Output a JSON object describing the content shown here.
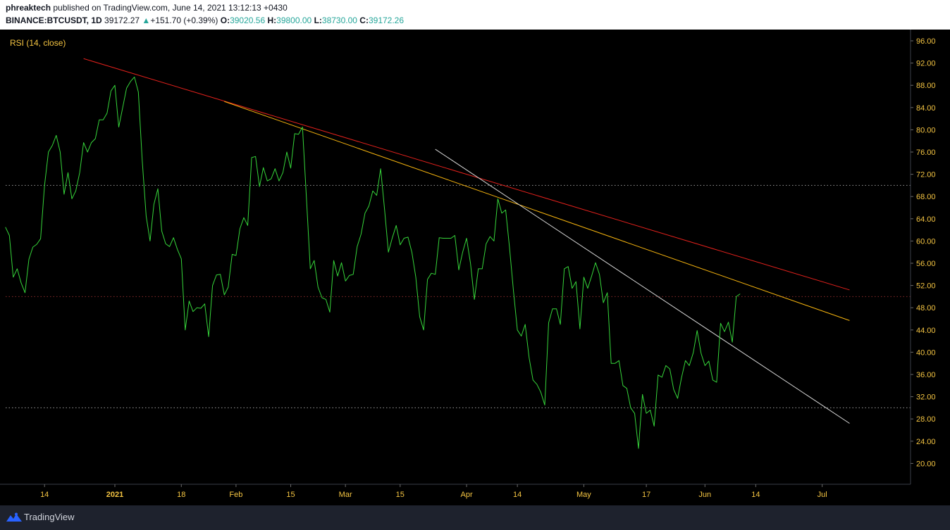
{
  "header": {
    "publisher": "phreaktech",
    "published_text": "published on TradingView.com, June 14, 2021 13:12:13 +0430",
    "symbol": "BINANCE:BTCUSDT, 1D",
    "last_price": "39172.27",
    "change_arrow": "▲",
    "change": "+151.70 (+0.39%)",
    "o_label": "O:",
    "open": "39020.56",
    "h_label": "H:",
    "high": "39800.00",
    "l_label": "L:",
    "low": "38730.00",
    "c_label": "C:",
    "close": "39172.26"
  },
  "footer": {
    "brand": "TradingView"
  },
  "colors": {
    "background": "#000000",
    "rsi_line": "#36d53a",
    "accent_up": "#26a69a",
    "trendline_red": "#e3211c",
    "trendline_orange": "#f6b40e",
    "trendline_white": "#d9d9d9",
    "indicator_label": "#f5c542",
    "axis_text": "#f5c542"
  },
  "chart_data": {
    "type": "line",
    "title": "RSI (14, close)",
    "y_axis_position": "right",
    "ylim": [
      16,
      99
    ],
    "yticks": [
      "96.00",
      "92.00",
      "88.00",
      "84.00",
      "80.00",
      "76.00",
      "72.00",
      "68.00",
      "64.00",
      "60.00",
      "56.00",
      "52.00",
      "48.00",
      "44.00",
      "40.00",
      "36.00",
      "32.00",
      "28.00",
      "24.00",
      "20.00"
    ],
    "reference_levels": [
      70,
      50,
      30
    ],
    "x_ticks": [
      {
        "label": "14",
        "date": "2020-12-14"
      },
      {
        "label": "2021",
        "date": "2021-01-01"
      },
      {
        "label": "18",
        "date": "2021-01-18"
      },
      {
        "label": "Feb",
        "date": "2021-02-01"
      },
      {
        "label": "15",
        "date": "2021-02-15"
      },
      {
        "label": "Mar",
        "date": "2021-03-01"
      },
      {
        "label": "15",
        "date": "2021-03-15"
      },
      {
        "label": "Apr",
        "date": "2021-04-01"
      },
      {
        "label": "14",
        "date": "2021-04-14"
      },
      {
        "label": "May",
        "date": "2021-05-01"
      },
      {
        "label": "17",
        "date": "2021-05-17"
      },
      {
        "label": "Jun",
        "date": "2021-06-01"
      },
      {
        "label": "14",
        "date": "2021-06-14"
      },
      {
        "label": "Jul",
        "date": "2021-07-01"
      }
    ],
    "series": [
      {
        "start_date": "2020-12-04",
        "values": [
          62.5,
          61,
          53.5,
          55,
          52.5,
          50.7,
          56.7,
          58.9,
          59.4,
          60.4,
          70,
          76,
          77.2,
          79,
          76,
          68.4,
          72.3,
          67.6,
          69,
          72.3,
          77.7,
          76,
          77.7,
          78.4,
          81.8,
          81.8,
          83,
          87,
          88,
          80.5,
          84,
          87.5,
          88.7,
          89.5,
          86.8,
          74.5,
          64.5,
          60,
          66.6,
          69.4,
          61.8,
          59.5,
          59,
          60.6,
          58.5,
          56.8,
          44,
          49.2,
          47.3,
          48,
          47.9,
          48.7,
          42.8,
          52,
          53.9,
          54,
          50.3,
          51.7,
          57.6,
          57.4,
          62.2,
          64.2,
          62.8,
          75,
          75.2,
          69.8,
          73.2,
          70.8,
          71.2,
          73,
          70.8,
          72.3,
          76,
          73.1,
          79.3,
          79.2,
          80.5,
          68,
          55,
          56.5,
          51.7,
          49.8,
          49.5,
          47.2,
          56.5,
          53.7,
          56.1,
          52.8,
          53.8,
          54,
          59,
          61.2,
          65,
          66.3,
          69,
          68.2,
          73,
          65.8,
          58,
          60.6,
          62.8,
          59.3,
          60.5,
          60.7,
          58,
          53.5,
          46.4,
          44,
          53.1,
          54.2,
          54,
          60.6,
          60.5,
          60.5,
          60.5,
          61,
          54.8,
          58,
          60.5,
          56,
          49.5,
          55,
          55,
          59.5,
          60.8,
          60,
          67.6,
          65,
          65.6,
          58.8,
          51,
          44,
          42.9,
          45,
          39,
          35,
          34.2,
          32.8,
          30.5,
          45.3,
          47.8,
          47.8,
          45,
          55,
          55.4,
          51.5,
          52.7,
          44.2,
          53.5,
          51.5,
          53.7,
          56.1,
          54,
          48.9,
          50.7,
          38,
          38,
          38.5,
          34,
          33.5,
          30,
          29,
          22.7,
          32.4,
          29,
          29.6,
          26.7,
          35.9,
          35.5,
          37.6,
          37,
          33.3,
          31.7,
          35.4,
          38.5,
          37.6,
          39.9,
          43.9,
          39.8,
          37.6,
          38.4,
          35,
          34.6,
          45.2,
          43.7,
          45.4,
          41.8,
          50,
          50.5
        ]
      }
    ],
    "trendlines": [
      {
        "color": "red",
        "from": {
          "date": "2020-12-24",
          "y": 92.8
        },
        "to": {
          "date": "2021-07-08",
          "y": 51.2
        }
      },
      {
        "color": "orange",
        "from": {
          "date": "2021-01-29",
          "y": 85.1
        },
        "to": {
          "date": "2021-07-08",
          "y": 45.7
        }
      },
      {
        "color": "white",
        "from": {
          "date": "2021-03-24",
          "y": 76.5
        },
        "to": {
          "date": "2021-07-08",
          "y": 27.2
        }
      }
    ]
  }
}
